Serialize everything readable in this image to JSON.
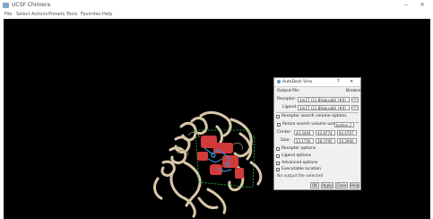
{
  "window": {
    "title": "UCSF Chimera",
    "minimize_glyph": "–",
    "close_glyph": "×"
  },
  "menu": [
    "File",
    "Select",
    "Actions",
    "Presets",
    "Tools",
    "Favorites",
    "Help"
  ],
  "panel": {
    "title": "AutoDock Vina",
    "help_glyph": "?",
    "close_glyph": "×",
    "output_file_label": "Output file:",
    "browse_label": "Browse",
    "receptor_label": "Receptor:",
    "receptor_value": "1m17 (11 Bhab.pdb) (#0)",
    "ligand_label": "Ligand:",
    "ligand_value": "1m17 (11 Bhab.pdb) (#0)",
    "receptor_search_options": "Receptor search volume options",
    "resize_label": "Resize search volume using",
    "resize_button": "button 2",
    "center_label": "Center:",
    "center_values": [
      "44.4404",
      "44.8774",
      "64.6797"
    ],
    "size_label": "Size:",
    "size_values": [
      "23.1726",
      "28.3795",
      "20.2960"
    ],
    "receptor_options": "Receptor options",
    "ligand_options": "Ligand options",
    "advanced_options": "Advanced options",
    "executable_location": "Executable location",
    "status": "No output file selected",
    "ok": "OK",
    "apply": "Apply",
    "close": "Close",
    "help": "Help"
  },
  "colors": {
    "viewer_background": "#000000",
    "ribbon": "#d8c7a7",
    "ligand_site": "#d23a3a",
    "pocket": "#3a8ccf",
    "box_edges": "#2fbf4a"
  }
}
